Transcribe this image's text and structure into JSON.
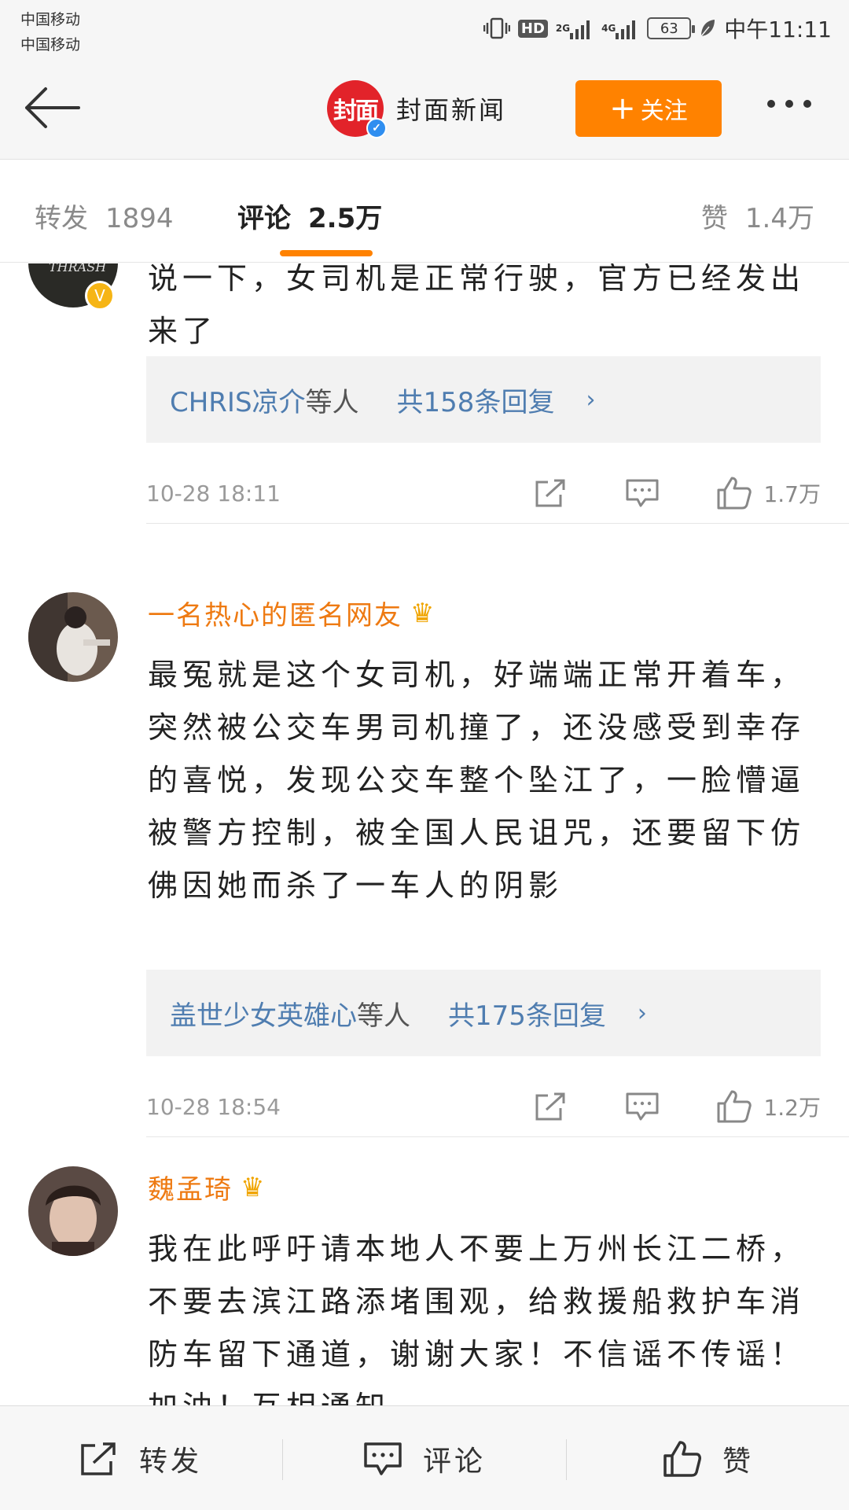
{
  "status_bar": {
    "carrier_1": "中国移动",
    "carrier_2": "中国移动",
    "hd": "HD",
    "net_1": "2G",
    "net_2": "4G",
    "battery": "63",
    "time": "中午11:11"
  },
  "header": {
    "logo_text": "封面",
    "account_name": "封面新闻",
    "follow_label": "关注",
    "icons": [
      "back-arrow-icon",
      "verified-icon",
      "more-icon"
    ]
  },
  "tabs": {
    "reposts": {
      "label": "转发",
      "count": "1894"
    },
    "comments": {
      "label": "评论",
      "count": "2.5万"
    },
    "likes": {
      "label": "赞",
      "count": "1.4万"
    }
  },
  "comments": [
    {
      "text": "说一下，女司机是正常行驶，官方已经发出来了",
      "reply_users": "CHRIS凉介",
      "reply_suffix": "等人",
      "reply_total": "共158条回复",
      "time": "10-28  18:11",
      "likes": "1.7万"
    },
    {
      "user": "一名热心的匿名网友",
      "text": "最冤就是这个女司机，好端端正常开着车，突然被公交车男司机撞了，还没感受到幸存的喜悦，发现公交车整个坠江了，一脸懵逼被警方控制，被全国人民诅咒，还要留下仿佛因她而杀了一车人的阴影",
      "reply_users": "盖世少女英雄心",
      "reply_suffix": "等人",
      "reply_total": "共175条回复",
      "time": "10-28  18:54",
      "likes": "1.2万"
    },
    {
      "user": "魏孟琦",
      "text": "我在此呼吁请本地人不要上万州长江二桥，不要去滨江路添堵围观，给救援船救护车消防车留下通道，谢谢大家！不信谣不传谣！加油！互相通知"
    }
  ],
  "bottom_bar": {
    "repost": "转发",
    "comment": "评论",
    "like": "赞"
  },
  "colors": {
    "accent": "#ff8200",
    "username": "#ee7a12",
    "reply_link": "#4f7db0",
    "logo": "#e2232a"
  }
}
